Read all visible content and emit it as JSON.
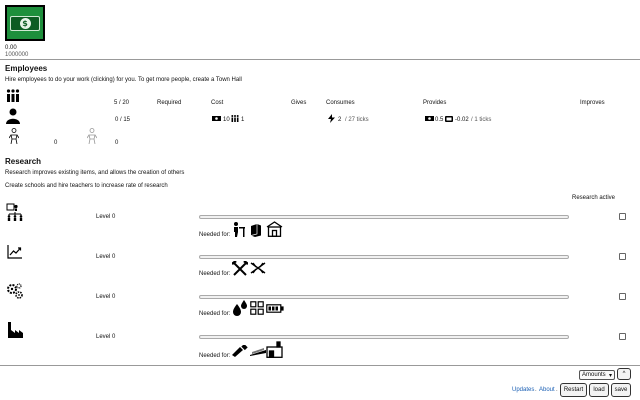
{
  "money": {
    "value": "0.00",
    "cap": "1000000"
  },
  "employees": {
    "title": "Employees",
    "description": "Hire employees to do your work (clicking) for you. To get more people, create a Town Hall",
    "headers": {
      "count": "5 / 20",
      "required": "Required",
      "cost": "Cost",
      "gives": "Gives",
      "consumes": "Consumes",
      "provides": "Provides",
      "improves": "Improves"
    },
    "worker": {
      "count": "0 / 15",
      "cost_money": "10",
      "cost_people": "1",
      "consumes_value": "2",
      "consumes_rate": "/ 27 ticks",
      "provides_money": "0.5",
      "provides_item": "-0.02",
      "provides_rate": "/ 1 ticks"
    },
    "small_units": {
      "a_count": "0",
      "b_count": "0"
    }
  },
  "research": {
    "title": "Research",
    "description1": "Research improves existing items, and allows the creation of others",
    "description2": "Create schools and hire teachers to increase rate of research",
    "active_label": "Research active",
    "needed_label": "Needed for:",
    "items": [
      {
        "icon": "organization-icon",
        "level": "Level 0"
      },
      {
        "icon": "trend-chart-icon",
        "level": "Level 0"
      },
      {
        "icon": "gears-icon",
        "level": "Level 0"
      },
      {
        "icon": "factory-icon",
        "level": "Level 0"
      }
    ]
  },
  "footer": {
    "select_value": "Amounts",
    "up_label": "^",
    "updates_label": "Updates",
    "about_label": "About",
    "restart_label": "Restart",
    "load_label": "load",
    "save_label": "save"
  }
}
